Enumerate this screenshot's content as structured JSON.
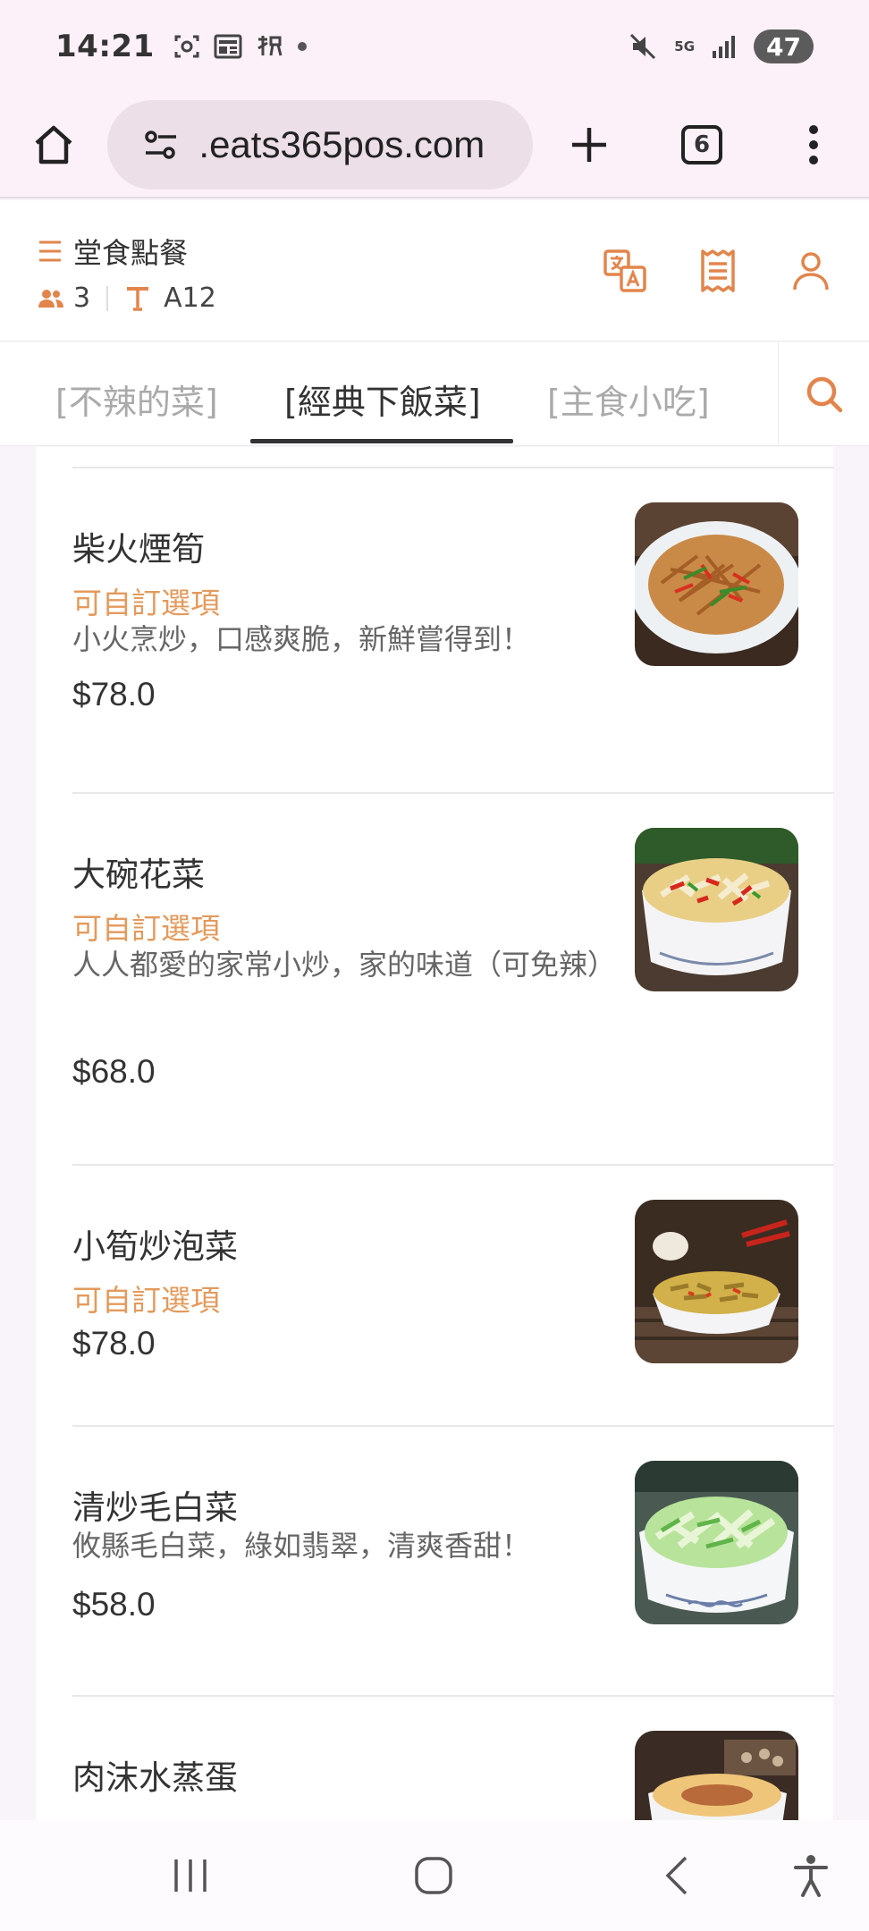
{
  "status_bar": {
    "time": "14:21",
    "network": "5G",
    "battery": "47"
  },
  "browser": {
    "url": " .eats365pos.com",
    "tab_count": "6"
  },
  "header": {
    "order_type": "堂食點餐",
    "guests": "3",
    "table": "A12"
  },
  "tabs": [
    {
      "label": "[不辣的菜]"
    },
    {
      "label": "[經典下飯菜]"
    },
    {
      "label": "[主食小吃]"
    }
  ],
  "dishes": [
    {
      "name": "柴火煙筍",
      "option": "可自訂選項",
      "description": "小火烹炒，口感爽脆，新鮮嘗得到！",
      "price": "$78.0"
    },
    {
      "name": "大碗花菜",
      "option": "可自訂選項",
      "description": "人人都愛的家常小炒，家的味道（可免辣）",
      "price": "$68.0"
    },
    {
      "name": "小筍炒泡菜",
      "option": "可自訂選項",
      "description": "",
      "price": "$78.0"
    },
    {
      "name": "清炒毛白菜",
      "option": "",
      "description": "攸縣毛白菜，綠如翡翠，清爽香甜！",
      "price": "$58.0"
    },
    {
      "name": "肉沫水蒸蛋",
      "option": "",
      "description": "",
      "price": ""
    }
  ],
  "colors": {
    "accent": "#e2854c",
    "option_text": "#e39a5c",
    "browser_bg": "#fcf0f9"
  }
}
